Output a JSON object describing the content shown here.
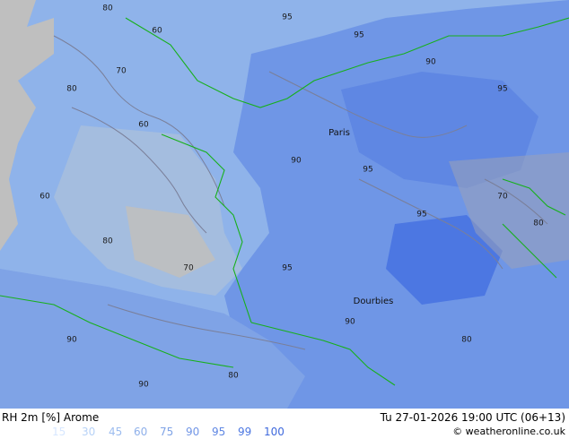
{
  "map": {
    "variable_label": "RH 2m [%]",
    "model_label": "Arome",
    "datetime_label": "Tu 27-01-2026 19:00 UTC (06+13)",
    "credit_label": "© weatheronline.co.uk",
    "cities": [
      {
        "name": "Paris"
      },
      {
        "name": "Dourbies"
      }
    ],
    "contour_labels": [
      "60",
      "70",
      "80",
      "90",
      "95"
    ],
    "legend": {
      "values": [
        "15",
        "30",
        "45",
        "60",
        "75",
        "90",
        "95",
        "99",
        "100"
      ],
      "colors": [
        "#d7e7ff",
        "#b7d2f7",
        "#9cbcef",
        "#8fb0ea",
        "#7fa3e6",
        "#7296e6",
        "#5f87e3",
        "#4c77e2",
        "#3f69dd"
      ]
    },
    "colors": {
      "sea": "#8fb3ea",
      "land_dry": "#bfbfbf",
      "land_humid": "#6f96e6",
      "coast": "#17b01b",
      "isohume": "#7a7f99"
    }
  }
}
